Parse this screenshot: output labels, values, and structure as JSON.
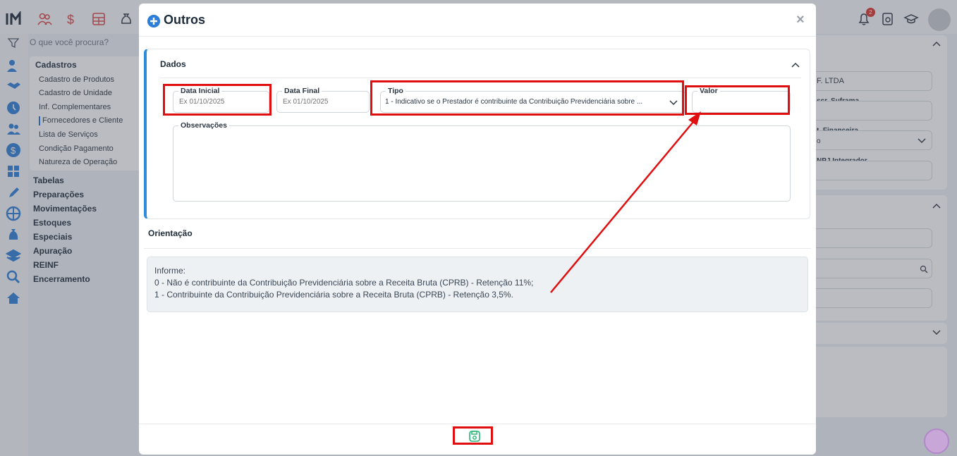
{
  "background": {
    "search_placeholder": "O que você procura?",
    "menu": {
      "title": "Cadastros",
      "items": [
        "Cadastro de Produtos",
        "Cadastro de Unidade",
        "Inf. Complementares",
        "Fornecedores e Cliente",
        "Lista de Serviços",
        "Condição Pagamento",
        "Natureza de Operação"
      ],
      "active_item": "Fornecedores e Cliente"
    },
    "groups": [
      "Tabelas",
      "Preparações",
      "Movimentações",
      "Estoques",
      "Especiais",
      "Apuração",
      "REINF",
      "Encerramento"
    ],
    "notification_count": "2",
    "right_panel": {
      "company": "F. LTDA",
      "label_suframa": "scr. Suframa",
      "label_financeira": "t. Financeira",
      "financeira_value": "o",
      "label_integrador": "NPJ Integrador"
    }
  },
  "modal": {
    "title": "Outros",
    "close_label": "×",
    "dados": {
      "title": "Dados",
      "data_inicial": {
        "label": "Data Inicial",
        "placeholder": "Ex 01/10/2025"
      },
      "data_final": {
        "label": "Data Final",
        "placeholder": "Ex 01/10/2025"
      },
      "tipo": {
        "label": "Tipo",
        "value": "1 - Indicativo se o Prestador é contribuinte da Contribuição Previdenciária sobre ..."
      },
      "valor": {
        "label": "Valor",
        "value": ""
      },
      "observacoes": {
        "label": "Observações"
      }
    },
    "orientacao": {
      "title": "Orientação",
      "lines": [
        "Informe:",
        "0 - Não é contribuinte da Contribuição Previdenciária sobre a Receita Bruta (CPRB) - Retenção 11%;",
        "1 - Contribuinte da Contribuição Previdenciária sobre a Receita Bruta (CPRB) - Retenção 3,5%."
      ]
    }
  },
  "colors": {
    "accent": "#2d8bdb",
    "highlight": "#e00e0e",
    "save_icon": "#22b573"
  }
}
